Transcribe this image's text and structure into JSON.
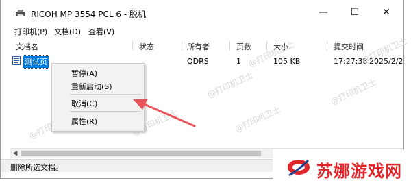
{
  "window": {
    "title": "RICOH MP 3554 PCL 6 - 脱机",
    "minimize": "—",
    "maximize": "☐",
    "close": "✕"
  },
  "menu": [
    "打印机(P)",
    "文档(D)",
    "查看(V)"
  ],
  "columns": [
    "文档名",
    "状态",
    "所有者",
    "页数",
    "大小",
    "提交时间"
  ],
  "job": {
    "name": "测试页",
    "owner": "QDRS",
    "pages": "1",
    "size": "105 KB",
    "time": "17:27:38",
    "date": "2025/2/2"
  },
  "context_menu": {
    "pause": "暂停(A)",
    "restart": "重新启动(S)",
    "cancel": "取消(C)",
    "properties": "属性(R)"
  },
  "status": "删除所选文档。",
  "watermark": "@打印机卫士",
  "brand": "苏娜游戏网",
  "colors": {
    "selection": "#0078d7",
    "arrow": "#e8545a",
    "brand": "#e0262a"
  }
}
